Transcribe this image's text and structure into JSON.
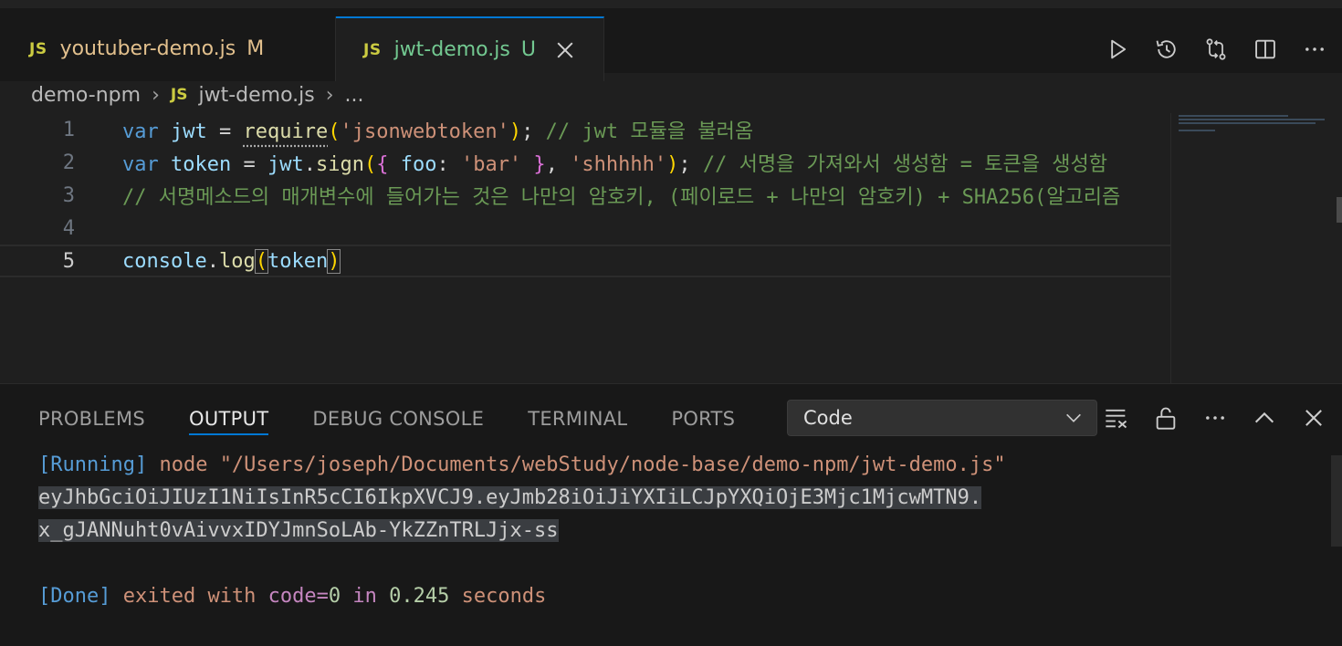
{
  "tabs": [
    {
      "icon": "JS",
      "name": "youtuber-demo.js",
      "status": "M"
    },
    {
      "icon": "JS",
      "name": "jwt-demo.js",
      "status": "U"
    }
  ],
  "breadcrumb": {
    "folder": "demo-npm",
    "icon": "JS",
    "file": "jwt-demo.js",
    "more": "..."
  },
  "editor": {
    "line_numbers": [
      "1",
      "2",
      "3",
      "4",
      "5"
    ],
    "line1": {
      "kw": "var",
      "name": "jwt",
      "op": " = ",
      "fn": "require",
      "p1": "(",
      "str": "'jsonwebtoken'",
      "p2": ")",
      "semi": "; ",
      "comment": "// jwt 모듈을 불러옴"
    },
    "line2": {
      "kw": "var",
      "name": "token",
      "op": " = ",
      "obj": "jwt",
      "dot": ".",
      "fn": "sign",
      "p1": "(",
      "b1": "{",
      "key": " foo",
      "colon": ": ",
      "str1": "'bar'",
      "b2": " }",
      "comma": ", ",
      "str2": "'shhhhh'",
      "p2": ")",
      "semi": "; ",
      "comment": "// 서명을 가져와서 생성함 = 토큰을 생성함"
    },
    "line3": {
      "comment": "// 서명메소드의 매개변수에 들어가는 것은 나만의 암호키, (페이로드 + 나만의 암호키) + SHA256(알고리즘"
    },
    "line5": {
      "obj": "console",
      "dot": ".",
      "fn": "log",
      "p1": "(",
      "arg": "token",
      "p2": ")"
    }
  },
  "panel": {
    "tabs": [
      "PROBLEMS",
      "OUTPUT",
      "DEBUG CONSOLE",
      "TERMINAL",
      "PORTS"
    ],
    "active_tab": "OUTPUT",
    "channel": "Code",
    "output": {
      "run_tag": "[Running]",
      "run_cmd": " node \"/Users/joseph/Documents/webStudy/node-base/demo-npm/jwt-demo.js\"",
      "token1": "eyJhbGciOiJIUzI1NiIsInR5cCI6IkpXVCJ9.eyJmb28iOiJiYXIiLCJpYXQiOjE3Mjc1MjcwMTN9.",
      "token2": "x_gJANNuht0vAivvxIDYJmnSoLAb-YkZZnTRLJjx-ss",
      "done_tag": "[Done]",
      "exited": " exited with ",
      "code_kw": "code=",
      "code_val": "0",
      "in_kw": " in ",
      "seconds_val": "0.245",
      "seconds_txt": " seconds"
    }
  },
  "colors": {
    "accent": "#0078d4",
    "modified": "#e2c08d",
    "untracked": "#73c991",
    "js_icon": "#cbcb41"
  }
}
